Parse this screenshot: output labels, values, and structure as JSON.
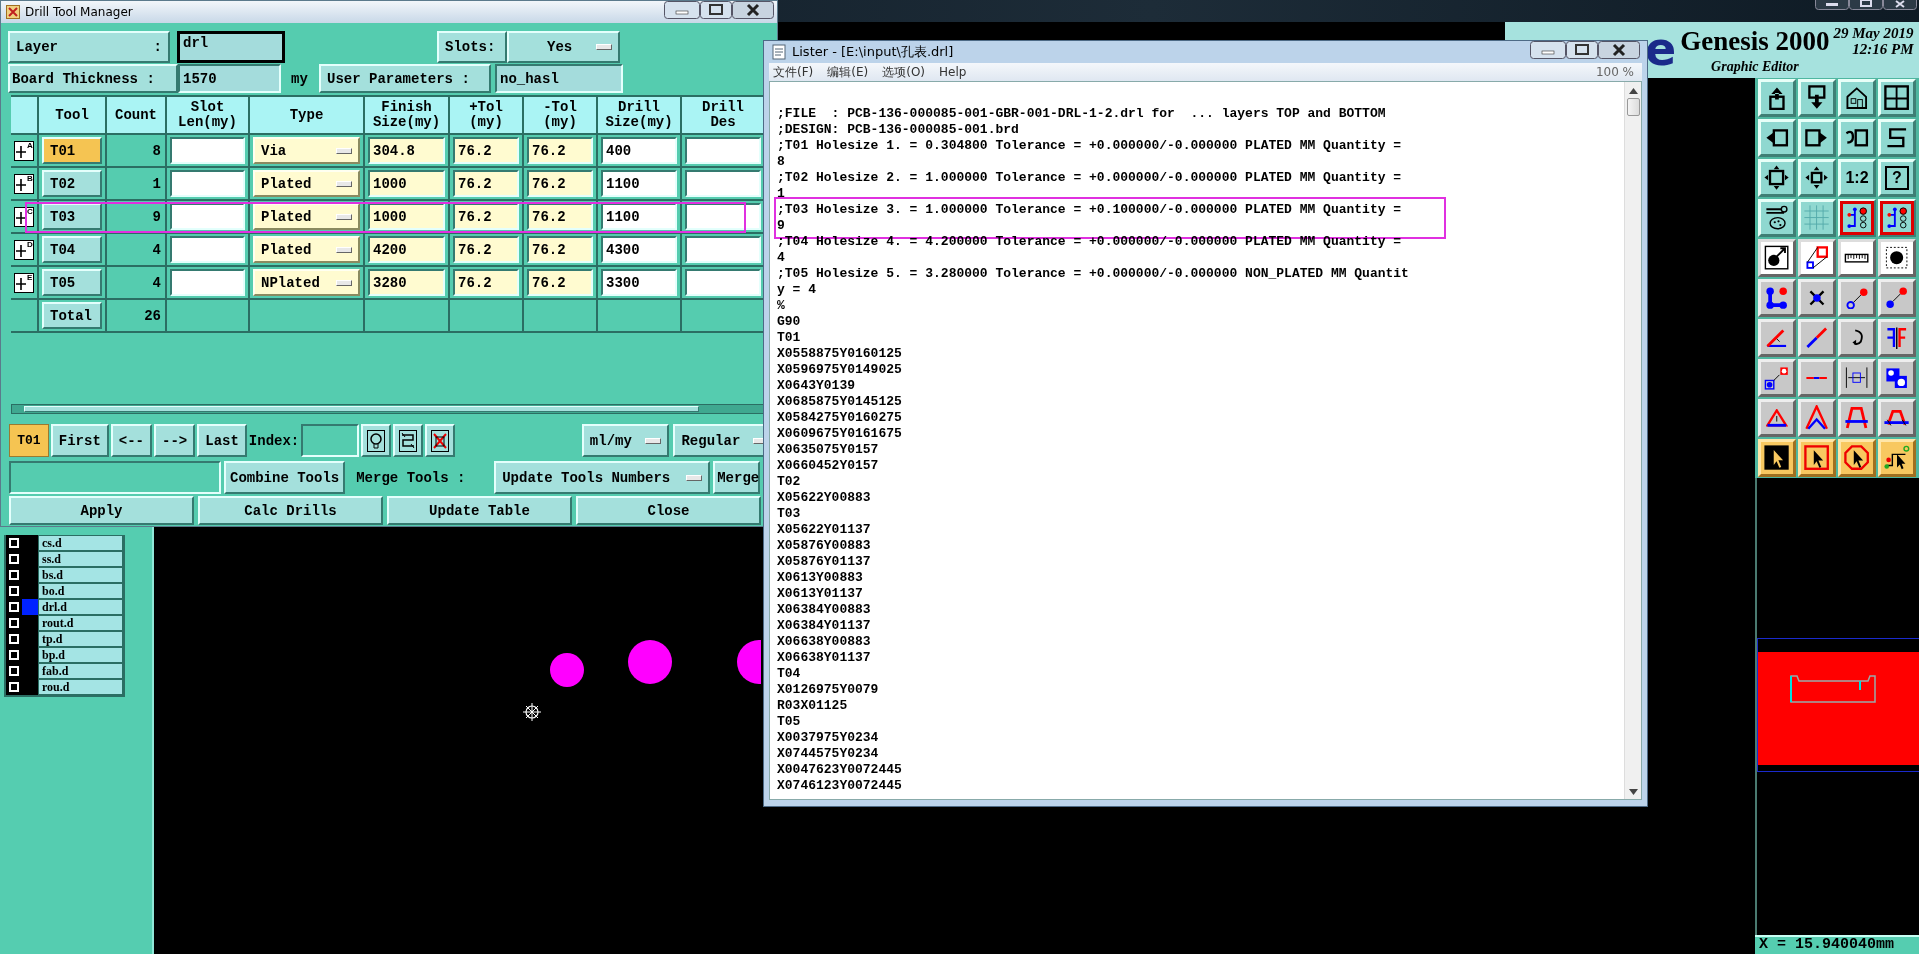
{
  "app": {
    "logo_fragment": "e",
    "product": "Genesis 2000",
    "subtitle": "Graphic Editor",
    "date": "29 May 2019",
    "time": "12:16 PM",
    "status": "X = 15.940040mm"
  },
  "layers": [
    {
      "name": "cs.d",
      "checked": false,
      "selected": false
    },
    {
      "name": "ss.d",
      "checked": false,
      "selected": false
    },
    {
      "name": "bs.d",
      "checked": false,
      "selected": false
    },
    {
      "name": "bo.d",
      "checked": false,
      "selected": false
    },
    {
      "name": "drl.d",
      "checked": false,
      "selected": true
    },
    {
      "name": "rout.d",
      "checked": false,
      "selected": false
    },
    {
      "name": "tp.d",
      "checked": false,
      "selected": false
    },
    {
      "name": "bp.d",
      "checked": false,
      "selected": false
    },
    {
      "name": "fab.d",
      "checked": false,
      "selected": false
    },
    {
      "name": "rou.d",
      "checked": false,
      "selected": false
    }
  ],
  "toolbar": [
    {
      "kind": "upload"
    },
    {
      "kind": "download"
    },
    {
      "kind": "home"
    },
    {
      "kind": "window-grid"
    },
    {
      "kind": "arrow-left-box"
    },
    {
      "kind": "arrow-right-box"
    },
    {
      "kind": "undo-box"
    },
    {
      "kind": "zigzag"
    },
    {
      "kind": "expand"
    },
    {
      "kind": "move-arrows"
    },
    {
      "kind": "text",
      "label": "1:2"
    },
    {
      "kind": "help",
      "label": "?"
    },
    {
      "kind": "tools-palette"
    },
    {
      "kind": "grid"
    },
    {
      "kind": "circuit"
    },
    {
      "kind": "circuit"
    },
    {
      "kind": "dot-arrow"
    },
    {
      "kind": "square-link"
    },
    {
      "kind": "ruler"
    },
    {
      "kind": "dot-frame"
    },
    {
      "kind": "nodes"
    },
    {
      "kind": "cross"
    },
    {
      "kind": "dot-arrow-outline"
    },
    {
      "kind": "dot-arrow-filled"
    },
    {
      "kind": "angle"
    },
    {
      "kind": "diagonal-line"
    },
    {
      "kind": "rotate"
    },
    {
      "kind": "mirror"
    },
    {
      "kind": "square-dot-link"
    },
    {
      "kind": "line-segment"
    },
    {
      "kind": "dimension"
    },
    {
      "kind": "shapes"
    },
    {
      "kind": "triangle"
    },
    {
      "kind": "arch"
    },
    {
      "kind": "arch-flat"
    },
    {
      "kind": "arch-ticks"
    },
    {
      "kind": "pointer-black"
    },
    {
      "kind": "pointer-square"
    },
    {
      "kind": "pointer-octagon"
    },
    {
      "kind": "pointer-step"
    }
  ],
  "drill_tool_manager": {
    "title": "Drill Tool Manager",
    "layer_label": "Layer",
    "layer_colon": ":",
    "layer_value": "drl",
    "slots_label": "Slots:",
    "slots_value": "Yes",
    "thickness_label": "Board Thickness :",
    "thickness_value": "1570",
    "thickness_unit": "my",
    "user_params_button": "User Parameters :",
    "user_params_value": "no_hasl",
    "columns": [
      "Tool",
      "Count",
      "Slot\nLen(my)",
      "Type",
      "Finish\nSize(my)",
      "+Tol\n(my)",
      "-Tol\n(my)",
      "Drill\nSize(my)",
      "Drill\nDes"
    ],
    "rows": [
      {
        "letter": "A",
        "tool": "T01",
        "selected": true,
        "highlighted": false,
        "count": "8",
        "type": "Via",
        "finish": "304.8",
        "plus_tol": "76.2",
        "minus_tol": "76.2",
        "drill_size": "400"
      },
      {
        "letter": "B",
        "tool": "T02",
        "selected": false,
        "highlighted": false,
        "count": "1",
        "type": "Plated",
        "finish": "1000",
        "plus_tol": "76.2",
        "minus_tol": "76.2",
        "drill_size": "1100"
      },
      {
        "letter": "C",
        "tool": "T03",
        "selected": false,
        "highlighted": true,
        "count": "9",
        "type": "Plated",
        "finish": "1000",
        "plus_tol": "76.2",
        "minus_tol": "76.2",
        "drill_size": "1100"
      },
      {
        "letter": "D",
        "tool": "T04",
        "selected": false,
        "highlighted": false,
        "count": "4",
        "type": "Plated",
        "finish": "4200",
        "plus_tol": "76.2",
        "minus_tol": "76.2",
        "drill_size": "4300"
      },
      {
        "letter": "E",
        "tool": "T05",
        "selected": false,
        "highlighted": false,
        "count": "4",
        "type": "NPlated",
        "finish": "3280",
        "plus_tol": "76.2",
        "minus_tol": "76.2",
        "drill_size": "3300"
      }
    ],
    "total": {
      "label": "Total",
      "count": "26"
    },
    "nav": {
      "current": "T01",
      "buttons": [
        "First",
        "<--",
        "-->",
        "Last"
      ],
      "index_label": "Index:",
      "units": "ml/my",
      "mode": "Regular"
    },
    "combine_button": "Combine Tools",
    "merge_label": "Merge Tools :",
    "merge_option": "Update Tools Numbers",
    "merge_button": "Merge",
    "actions": [
      "Apply",
      "Calc Drills",
      "Update Table",
      "Close"
    ]
  },
  "lister": {
    "title": "Lister - [E:\\input\\孔表.drl]",
    "menu": [
      "文件(F)",
      "编辑(E)",
      "选项(O)",
      "Help"
    ],
    "zoom": "100 %",
    "lines": [
      {
        "text": ";FILE  : PCB-136-000085-001-GBR-001-DRL-1-2.drl for  ... layers TOP and BOTTOM",
        "highlighted": false
      },
      {
        "text": ";DESIGN: PCB-136-000085-001.brd",
        "highlighted": false
      },
      {
        "text": ";T01 Holesize 1. = 0.304800 Tolerance = +0.000000/-0.000000 PLATED MM Quantity =",
        "highlighted": false
      },
      {
        "text": "8",
        "highlighted": false
      },
      {
        "text": ";T02 Holesize 2. = 1.000000 Tolerance = +0.000000/-0.000000 PLATED MM Quantity =",
        "highlighted": false
      },
      {
        "text": "1",
        "highlighted": false
      },
      {
        "text": ";T03 Holesize 3. = 1.000000 Tolerance = +0.100000/-0.000000 PLATED MM Quantity =",
        "highlighted": true
      },
      {
        "text": "9",
        "highlighted": true
      },
      {
        "text": ";T04 Holesize 4. = 4.200000 Tolerance = +0.000000/-0.000000 PLATED MM Quantity =",
        "highlighted": false
      },
      {
        "text": "4",
        "highlighted": false
      },
      {
        "text": ";T05 Holesize 5. = 3.280000 Tolerance = +0.000000/-0.000000 NON_PLATED MM Quantit",
        "highlighted": false
      },
      {
        "text": "y = 4",
        "highlighted": false
      },
      {
        "text": "%",
        "highlighted": false
      },
      {
        "text": "G90",
        "highlighted": false
      },
      {
        "text": "T01",
        "highlighted": false
      },
      {
        "text": "X0558875Y0160125",
        "highlighted": false
      },
      {
        "text": "X0596975Y0149025",
        "highlighted": false
      },
      {
        "text": "X0643Y0139",
        "highlighted": false
      },
      {
        "text": "X0685875Y0145125",
        "highlighted": false
      },
      {
        "text": "X0584275Y0160275",
        "highlighted": false
      },
      {
        "text": "X0609675Y0161675",
        "highlighted": false
      },
      {
        "text": "X0635075Y0157",
        "highlighted": false
      },
      {
        "text": "X0660452Y0157",
        "highlighted": false
      },
      {
        "text": "T02",
        "highlighted": false
      },
      {
        "text": "X05622Y00883",
        "highlighted": false
      },
      {
        "text": "T03",
        "highlighted": false
      },
      {
        "text": "X05622Y01137",
        "highlighted": false
      },
      {
        "text": "X05876Y00883",
        "highlighted": false
      },
      {
        "text": "X05876Y01137",
        "highlighted": false
      },
      {
        "text": "X0613Y00883",
        "highlighted": false
      },
      {
        "text": "X0613Y01137",
        "highlighted": false
      },
      {
        "text": "X06384Y00883",
        "highlighted": false
      },
      {
        "text": "X06384Y01137",
        "highlighted": false
      },
      {
        "text": "X06638Y00883",
        "highlighted": false
      },
      {
        "text": "X06638Y01137",
        "highlighted": false
      },
      {
        "text": "T04",
        "highlighted": false
      },
      {
        "text": "X0126975Y0079",
        "highlighted": false
      },
      {
        "text": "R03X01125",
        "highlighted": false
      },
      {
        "text": "T05",
        "highlighted": false
      },
      {
        "text": "X0037975Y0234",
        "highlighted": false
      },
      {
        "text": "X0744575Y0234",
        "highlighted": false
      },
      {
        "text": "X0047623Y0072445",
        "highlighted": false
      },
      {
        "text": "X0746123Y0072445",
        "highlighted": false
      }
    ]
  }
}
